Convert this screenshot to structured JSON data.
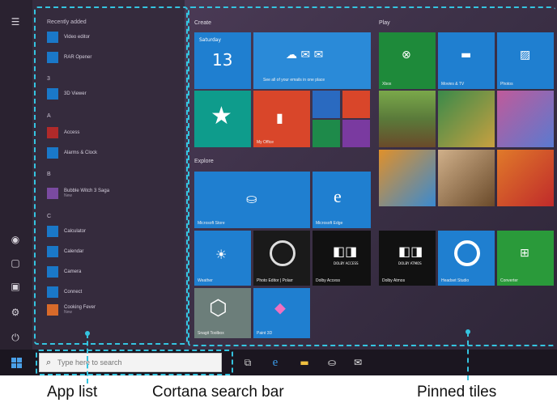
{
  "start_menu": {
    "rail_icons": [
      "hamburger-menu-icon",
      "user-icon",
      "document-icon",
      "pictures-icon",
      "settings-icon",
      "power-icon"
    ],
    "app_list": {
      "section_header": "Recently added",
      "letters": [
        "3",
        "A",
        "B",
        "C"
      ],
      "apps": [
        {
          "name": "Video editor",
          "sub": ""
        },
        {
          "name": "RAR Opener",
          "sub": ""
        },
        {
          "name": "3D Viewer",
          "sub": ""
        },
        {
          "name": "Access",
          "sub": ""
        },
        {
          "name": "Alarms & Clock",
          "sub": ""
        },
        {
          "name": "Bubble Witch 3 Saga",
          "sub": "New"
        },
        {
          "name": "Calculator",
          "sub": ""
        },
        {
          "name": "Calendar",
          "sub": ""
        },
        {
          "name": "Camera",
          "sub": ""
        },
        {
          "name": "Connect",
          "sub": ""
        },
        {
          "name": "Cooking Fever",
          "sub": "New"
        }
      ]
    },
    "groups": {
      "create": "Create",
      "explore": "Explore",
      "play": "Play"
    },
    "tiles": {
      "calendar_day": "Saturday",
      "calendar_date": "13",
      "mail_caption": "See all of your emails in one place",
      "my_office": "My Office",
      "store": "Microsoft Store",
      "edge": "Microsoft Edge",
      "weather": "Weather",
      "photo_editor": "Photo Editor | Polarr",
      "dolby_access": "Dolby Access",
      "dolby_access_label": "DOLBY ACCESS",
      "xbox": "Xbox",
      "movies": "Movies & TV",
      "photos": "Photos",
      "dolby_atmos": "Dolby Atmos",
      "dolby_atmos_label": "DOLBY ATMOS",
      "headset": "Headset Studio",
      "converter": "Converter",
      "paint3d": "Paint 3D",
      "mini_tools": "Snagit Toolbox"
    }
  },
  "taskbar": {
    "search_placeholder": "Type here to search",
    "pinned": [
      "task-view-icon",
      "edge-icon",
      "file-explorer-icon",
      "store-icon",
      "mail-icon"
    ]
  },
  "annotations": {
    "app_list": "App list",
    "search_bar": "Cortana search bar",
    "pinned_tiles": "Pinned tiles"
  },
  "colors": {
    "accent": "#1f7fd0",
    "callout": "#35c4e0"
  }
}
